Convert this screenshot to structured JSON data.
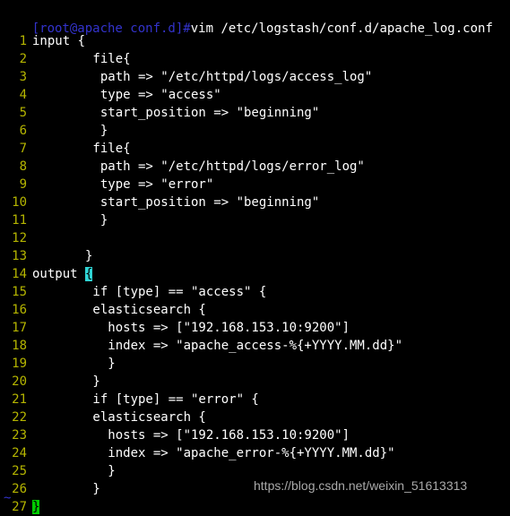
{
  "terminal": {
    "background_color": "#000000",
    "foreground_color": "#ffffff",
    "prompt_color": "#3333cc",
    "lineno_color": "#b5b500",
    "cursor_color": "#2fd4d4",
    "brace_match_color": "#00cc00"
  },
  "shell": {
    "prompt": "[root@apache conf.d]#",
    "command": "vim /etc/logstash/conf.d/apache_log.conf"
  },
  "editor": {
    "filename": "apache_log.conf",
    "cursor_line": 14,
    "lines": [
      {
        "n": "1",
        "before": "input {",
        "cursor": "",
        "after": ""
      },
      {
        "n": "2",
        "before": "        file{",
        "cursor": "",
        "after": ""
      },
      {
        "n": "3",
        "before": "         path => \"/etc/httpd/logs/access_log\"",
        "cursor": "",
        "after": ""
      },
      {
        "n": "4",
        "before": "         type => \"access\"",
        "cursor": "",
        "after": ""
      },
      {
        "n": "5",
        "before": "         start_position => \"beginning\"",
        "cursor": "",
        "after": ""
      },
      {
        "n": "6",
        "before": "         }",
        "cursor": "",
        "after": ""
      },
      {
        "n": "7",
        "before": "        file{",
        "cursor": "",
        "after": ""
      },
      {
        "n": "8",
        "before": "         path => \"/etc/httpd/logs/error_log\"",
        "cursor": "",
        "after": ""
      },
      {
        "n": "9",
        "before": "         type => \"error\"",
        "cursor": "",
        "after": ""
      },
      {
        "n": "10",
        "before": "         start_position => \"beginning\"",
        "cursor": "",
        "after": ""
      },
      {
        "n": "11",
        "before": "         }",
        "cursor": "",
        "after": ""
      },
      {
        "n": "12",
        "before": "",
        "cursor": "",
        "after": ""
      },
      {
        "n": "13",
        "before": "       }",
        "cursor": "",
        "after": ""
      },
      {
        "n": "14",
        "before": "output ",
        "cursor": "{",
        "after": ""
      },
      {
        "n": "15",
        "before": "        if [type] == \"access\" {",
        "cursor": "",
        "after": ""
      },
      {
        "n": "16",
        "before": "        elasticsearch {",
        "cursor": "",
        "after": ""
      },
      {
        "n": "17",
        "before": "          hosts => [\"192.168.153.10:9200\"]",
        "cursor": "",
        "after": ""
      },
      {
        "n": "18",
        "before": "          index => \"apache_access-%{+YYYY.MM.dd}\"",
        "cursor": "",
        "after": ""
      },
      {
        "n": "19",
        "before": "          }",
        "cursor": "",
        "after": ""
      },
      {
        "n": "20",
        "before": "        }",
        "cursor": "",
        "after": ""
      },
      {
        "n": "21",
        "before": "        if [type] == \"error\" {",
        "cursor": "",
        "after": ""
      },
      {
        "n": "22",
        "before": "        elasticsearch {",
        "cursor": "",
        "after": ""
      },
      {
        "n": "23",
        "before": "          hosts => [\"192.168.153.10:9200\"]",
        "cursor": "",
        "after": ""
      },
      {
        "n": "24",
        "before": "          index => \"apache_error-%{+YYYY.MM.dd}\"",
        "cursor": "",
        "after": ""
      },
      {
        "n": "25",
        "before": "          }",
        "cursor": "",
        "after": ""
      },
      {
        "n": "26",
        "before": "        }",
        "cursor": "",
        "after": ""
      },
      {
        "n": "27",
        "before": "",
        "cursor": "",
        "after": "",
        "brace_match": "}"
      }
    ],
    "tilde_rows": [
      "~"
    ]
  },
  "watermark": {
    "text": "https://blog.csdn.net/weixin_51613313"
  }
}
